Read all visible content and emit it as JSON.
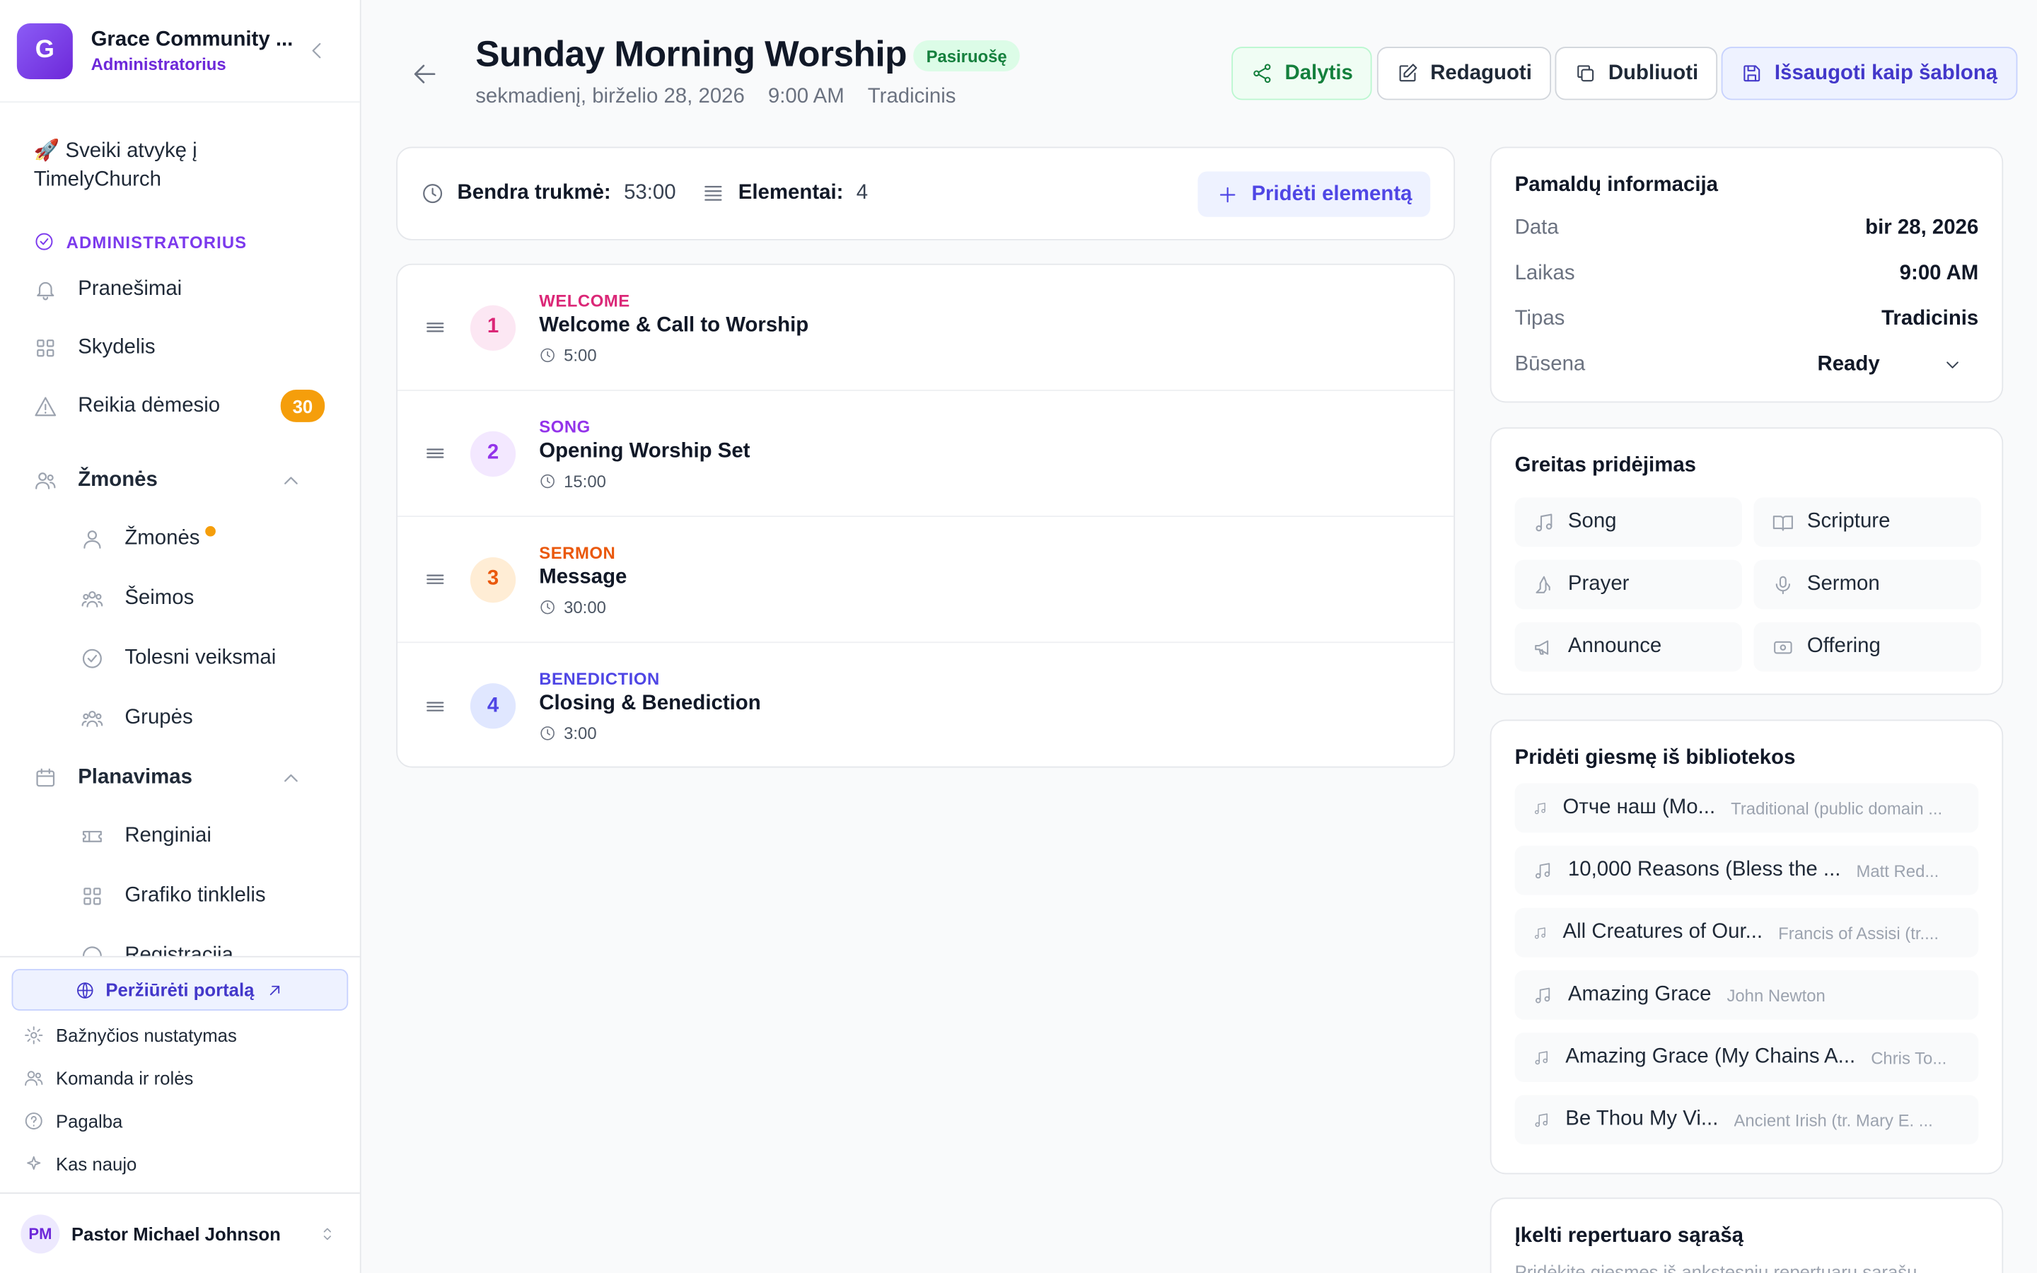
{
  "org": {
    "initial": "G",
    "name": "Grace Community ...",
    "role": "Administratorius"
  },
  "sidebar": {
    "welcome": "🚀 Sveiki atvykę į TimelyChurch",
    "section_label": "ADMINISTRATORIUS",
    "top_items": [
      {
        "label": "Pranešimai",
        "icon": "bell-icon"
      },
      {
        "label": "Skydelis",
        "icon": "grid-icon"
      },
      {
        "label": "Reikia dėmesio",
        "icon": "warning-icon",
        "badge": "30"
      }
    ],
    "people_group": {
      "label": "Žmonės",
      "items": [
        "Žmonės",
        "Šeimos",
        "Tolesni veiksmai",
        "Grupės"
      ]
    },
    "planning_group": {
      "label": "Planavimas",
      "items": [
        "Renginiai",
        "Grafiko tinklelis",
        "Registracija"
      ]
    },
    "portal_button": "Peržiūrėti portalą",
    "footer_items": [
      "Bažnyčios nustatymas",
      "Komanda ir rolės",
      "Pagalba",
      "Kas naujo"
    ],
    "user": {
      "initials": "PM",
      "name": "Pastor Michael Johnson"
    }
  },
  "service": {
    "title": "Sunday Morning Worship",
    "status": "Pasiruošę",
    "date": "sekmadienį, birželio 28, 2026",
    "time": "9:00 AM",
    "type": "Tradicinis"
  },
  "actions": {
    "share": "Dalytis",
    "edit": "Redaguoti",
    "duplicate": "Dubliuoti",
    "save_template": "Išsaugoti kaip šabloną"
  },
  "summary": {
    "duration_label": "Bendra trukmė:",
    "duration": "53:00",
    "elements_label": "Elementai:",
    "elements": "4",
    "add_element": "Pridėti elementą"
  },
  "items": [
    {
      "num": "1",
      "category": "WELCOME",
      "title": "Welcome & Call to Worship",
      "duration": "5:00",
      "color": "#db2777",
      "bg": "#fce7f3"
    },
    {
      "num": "2",
      "category": "SONG",
      "title": "Opening Worship Set",
      "duration": "15:00",
      "color": "#9333ea",
      "bg": "#f3e8ff"
    },
    {
      "num": "3",
      "category": "SERMON",
      "title": "Message",
      "duration": "30:00",
      "color": "#ea580c",
      "bg": "#ffedd5"
    },
    {
      "num": "4",
      "category": "BENEDICTION",
      "title": "Closing & Benediction",
      "duration": "3:00",
      "color": "#4f46e5",
      "bg": "#e0e7ff"
    }
  ],
  "info": {
    "title": "Pamaldų informacija",
    "rows": [
      {
        "key": "Data",
        "value": "bir 28, 2026"
      },
      {
        "key": "Laikas",
        "value": "9:00 AM"
      },
      {
        "key": "Tipas",
        "value": "Tradicinis"
      }
    ],
    "status_key": "Būsena",
    "status_value": "Ready"
  },
  "quick_add": {
    "title": "Greitas pridėjimas",
    "buttons": [
      "Song",
      "Scripture",
      "Prayer",
      "Sermon",
      "Announce",
      "Offering"
    ]
  },
  "library": {
    "title": "Pridėti giesmę iš bibliotekos",
    "songs": [
      {
        "title": "Отче наш (Mo...",
        "author": "Traditional (public domain ..."
      },
      {
        "title": "10,000 Reasons (Bless the ...",
        "author": "Matt Red..."
      },
      {
        "title": "All Creatures of Our...",
        "author": "Francis of Assisi (tr...."
      },
      {
        "title": "Amazing Grace",
        "author": "John Newton"
      },
      {
        "title": "Amazing Grace (My Chains A...",
        "author": "Chris To..."
      },
      {
        "title": "Be Thou My Vi...",
        "author": "Ancient Irish (tr. Mary E. ..."
      }
    ]
  },
  "setlist": {
    "title": "Įkelti repertuaro sąrašą",
    "subtitle": "Pridėkite giesmes iš ankstesnių repertuarų sąrašų"
  }
}
